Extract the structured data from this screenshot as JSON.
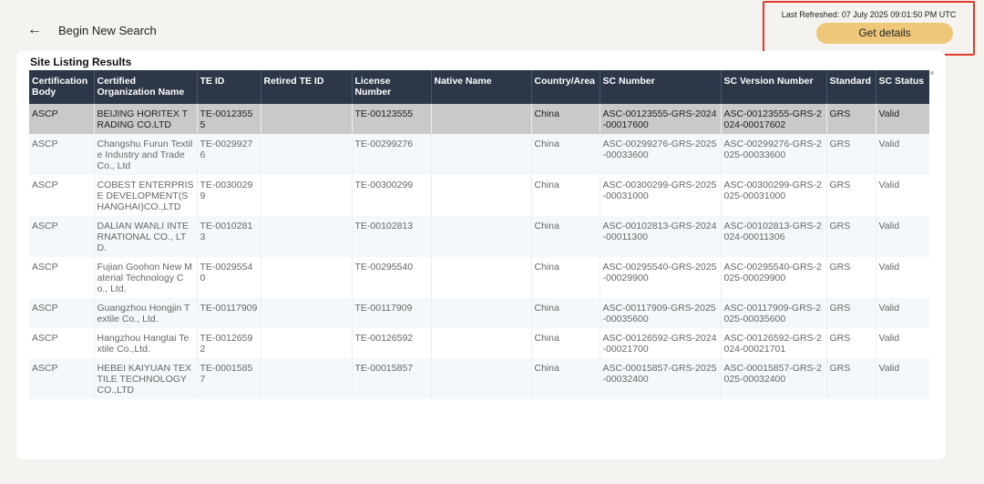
{
  "nav": {
    "back_label": "Begin New Search"
  },
  "refresh": {
    "text": "Last Refreshed: 07 July 2025 09:01:50 PM UTC",
    "button_label": "Get details"
  },
  "results": {
    "title": "Site Listing Results",
    "columns": [
      "Certification Body",
      "Certified Organization Name",
      "TE ID",
      "Retired TE ID",
      "License Number",
      "Native Name",
      "Country/Area",
      "SC Number",
      "SC Version Number",
      "Standard",
      "SC Status"
    ],
    "rows": [
      [
        "ASCP",
        "BEIJING HORITEX TRADING CO.LTD",
        "TE-00123555",
        "",
        "TE-00123555",
        "",
        "China",
        "ASC-00123555-GRS-2024-00017600",
        "ASC-00123555-GRS-2024-00017602",
        "GRS",
        "Valid"
      ],
      [
        "ASCP",
        "Changshu Furun Textile Industry and Trade Co., Ltd",
        "TE-00299276",
        "",
        "TE-00299276",
        "",
        "China",
        "ASC-00299276-GRS-2025-00033600",
        "ASC-00299276-GRS-2025-00033600",
        "GRS",
        "Valid"
      ],
      [
        "ASCP",
        "COBEST ENTERPRISE DEVELOPMENT(SHANGHAI)CO.,LTD",
        "TE-00300299",
        "",
        "TE-00300299",
        "",
        "China",
        "ASC-00300299-GRS-2025-00031000",
        "ASC-00300299-GRS-2025-00031000",
        "GRS",
        "Valid"
      ],
      [
        "ASCP",
        "DALIAN WANLI INTERNATIONAL CO., LTD.",
        "TE-00102813",
        "",
        "TE-00102813",
        "",
        "China",
        "ASC-00102813-GRS-2024-00011300",
        "ASC-00102813-GRS-2024-00011306",
        "GRS",
        "Valid"
      ],
      [
        "ASCP",
        "Fujian Goohon New Material Technology Co., Ltd.",
        "TE-00295540",
        "",
        "TE-00295540",
        "",
        "China",
        "ASC-00295540-GRS-2025-00029900",
        "ASC-00295540-GRS-2025-00029900",
        "GRS",
        "Valid"
      ],
      [
        "ASCP",
        "Guangzhou Hongjin Textile Co., Ltd.",
        "TE-00117909",
        "",
        "TE-00117909",
        "",
        "China",
        "ASC-00117909-GRS-2025-00035600",
        "ASC-00117909-GRS-2025-00035600",
        "GRS",
        "Valid"
      ],
      [
        "ASCP",
        "Hangzhou Hangtai Textile Co.,Ltd.",
        "TE-00126592",
        "",
        "TE-00126592",
        "",
        "China",
        "ASC-00126592-GRS-2024-00021700",
        "ASC-00126592-GRS-2024-00021701",
        "GRS",
        "Valid"
      ],
      [
        "ASCP",
        "HEBEI KAIYUAN TEXTILE TECHNOLOGY CO.,LTD",
        "TE-00015857",
        "",
        "TE-00015857",
        "",
        "China",
        "ASC-00015857-GRS-2025-00032400",
        "ASC-00015857-GRS-2025-00032400",
        "GRS",
        "Valid"
      ]
    ]
  }
}
